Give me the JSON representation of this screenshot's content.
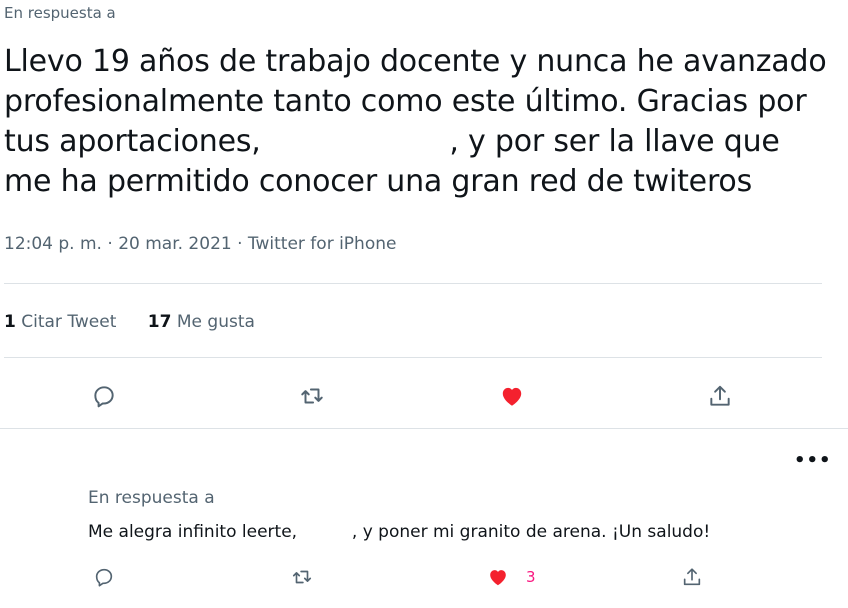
{
  "tweet": {
    "reply_label": "En respuesta a",
    "text_part1": "Llevo 19 años de trabajo docente y nunca he avanzado profesionalmente tanto como este último. Gracias por tus aportaciones,",
    "text_part2": ", y por ser la llave que me ha permitido conocer una gran red de twiteros",
    "time": "12:04 p. m.",
    "sep": "·",
    "date": "20 mar. 2021",
    "source": "Twitter for iPhone",
    "quote_count": "1",
    "quote_label": "Citar Tweet",
    "like_count": "17",
    "like_label": "Me gusta"
  },
  "icons": {
    "reply": "reply-icon",
    "retweet": "retweet-icon",
    "like": "heart-filled-icon",
    "share": "share-icon",
    "more": "more-icon",
    "like_color": "#f4212e"
  },
  "reply": {
    "more_label": "•••",
    "reply_label": "En respuesta a",
    "text_part1": "Me alegra infinito leerte,",
    "text_part2": ", y poner mi granito de arena. ¡Un saludo!",
    "like_count": "3"
  }
}
